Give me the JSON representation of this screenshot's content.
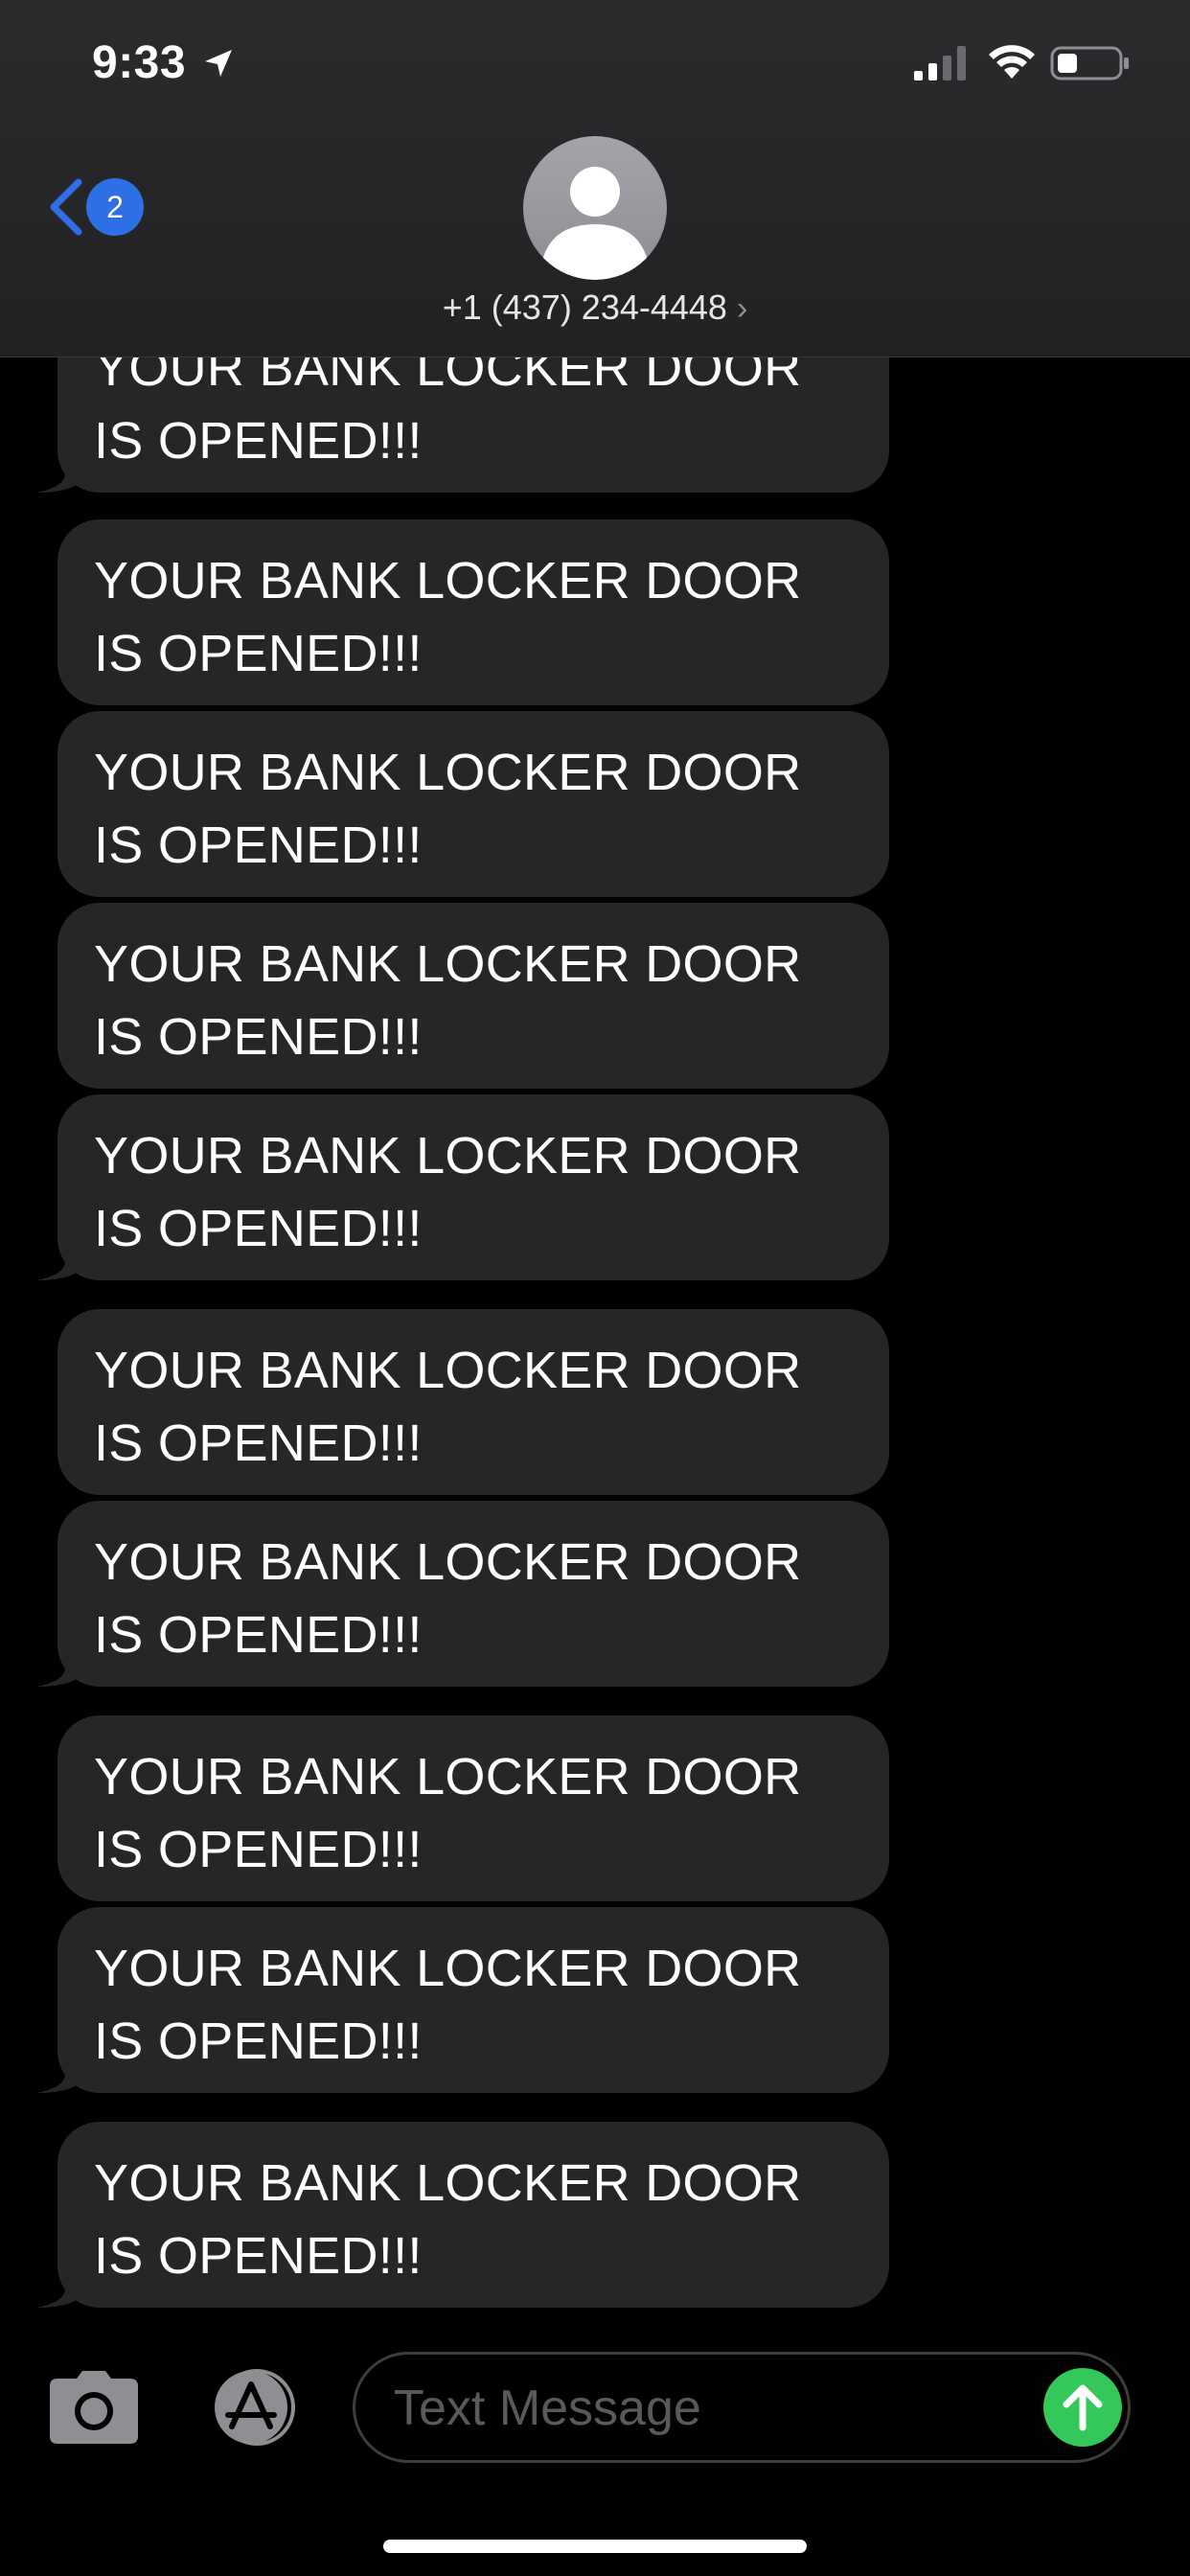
{
  "status_bar": {
    "time": "9:33",
    "icons": [
      "location-arrow-icon",
      "cellular-signal-icon",
      "wifi-icon",
      "battery-icon"
    ]
  },
  "header": {
    "back_badge": "2",
    "contact_name": "+1 (437) 234-4448",
    "contact_chevron": "›"
  },
  "messages": [
    {
      "text": "YOUR BANK LOCKER DOOR IS OPENED!!!"
    },
    {
      "text": "YOUR BANK LOCKER DOOR IS OPENED!!!"
    },
    {
      "text": "YOUR BANK LOCKER DOOR IS OPENED!!!"
    },
    {
      "text": "YOUR BANK LOCKER DOOR IS OPENED!!!"
    },
    {
      "text": "YOUR BANK LOCKER DOOR IS OPENED!!!"
    },
    {
      "text": "YOUR BANK LOCKER DOOR IS OPENED!!!"
    },
    {
      "text": "YOUR BANK LOCKER DOOR IS OPENED!!!"
    },
    {
      "text": "YOUR BANK LOCKER DOOR IS OPENED!!!"
    },
    {
      "text": "YOUR BANK LOCKER DOOR IS OPENED!!!"
    },
    {
      "text": "YOUR BANK LOCKER DOOR IS OPENED!!!"
    }
  ],
  "composer": {
    "placeholder": "Text Message",
    "icons": [
      "camera-icon",
      "app-store-icon",
      "send-arrow-icon"
    ]
  },
  "colors": {
    "background": "#000000",
    "bubble": "#262629",
    "accent_blue": "#2f6fe6",
    "send_green": "#34c759"
  }
}
